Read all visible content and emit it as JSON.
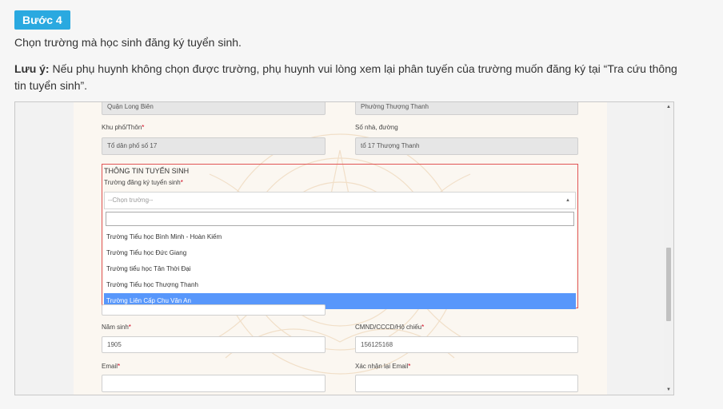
{
  "step": {
    "badge": "Bước 4"
  },
  "instruction": "Chọn trường mà học sinh đăng ký tuyển sinh.",
  "note": {
    "label": "Lưu ý:",
    "text": " Nếu phụ huynh không chọn được trường, phụ huynh vui lòng xem lại phân tuyến của trường muốn đăng ký tại “Tra cứu thông tin tuyển sinh”."
  },
  "form": {
    "district_value": "Quận Long Biên",
    "ward_value": "Phường Thượng Thanh",
    "hamlet_label": "Khu phố/Thôn",
    "hamlet_value": "Tổ dân phố số 17",
    "street_label": "Số nhà, đường",
    "street_value": "tổ 17 Thượng Thanh",
    "section_title": "THÔNG TIN TUYỂN SINH",
    "school_label": "Trường đăng ký tuyển sinh",
    "school_placeholder": "--Chọn trường--",
    "school_options": [
      "Trường Tiểu học Bình Minh - Hoàn Kiếm",
      "Trường Tiểu học Đức Giang",
      "Trường tiểu học Tân Thời Đại",
      "Trường Tiểu học Thượng Thanh",
      "Trường Liên Cấp Chu Văn An"
    ],
    "school_selected_index": 4,
    "birth_year_label": "Năm sinh",
    "birth_year_value": "1905",
    "id_label": "CMND/CCCD/Hộ chiếu",
    "id_value": "156125168",
    "email_label": "Email",
    "email_confirm_label": "Xác nhận lại Email",
    "required_mark": "*"
  },
  "colors": {
    "badge": "#2aa9e0",
    "highlight_border": "#e05555",
    "option_active": "#5897fb",
    "required": "#d0021b"
  }
}
